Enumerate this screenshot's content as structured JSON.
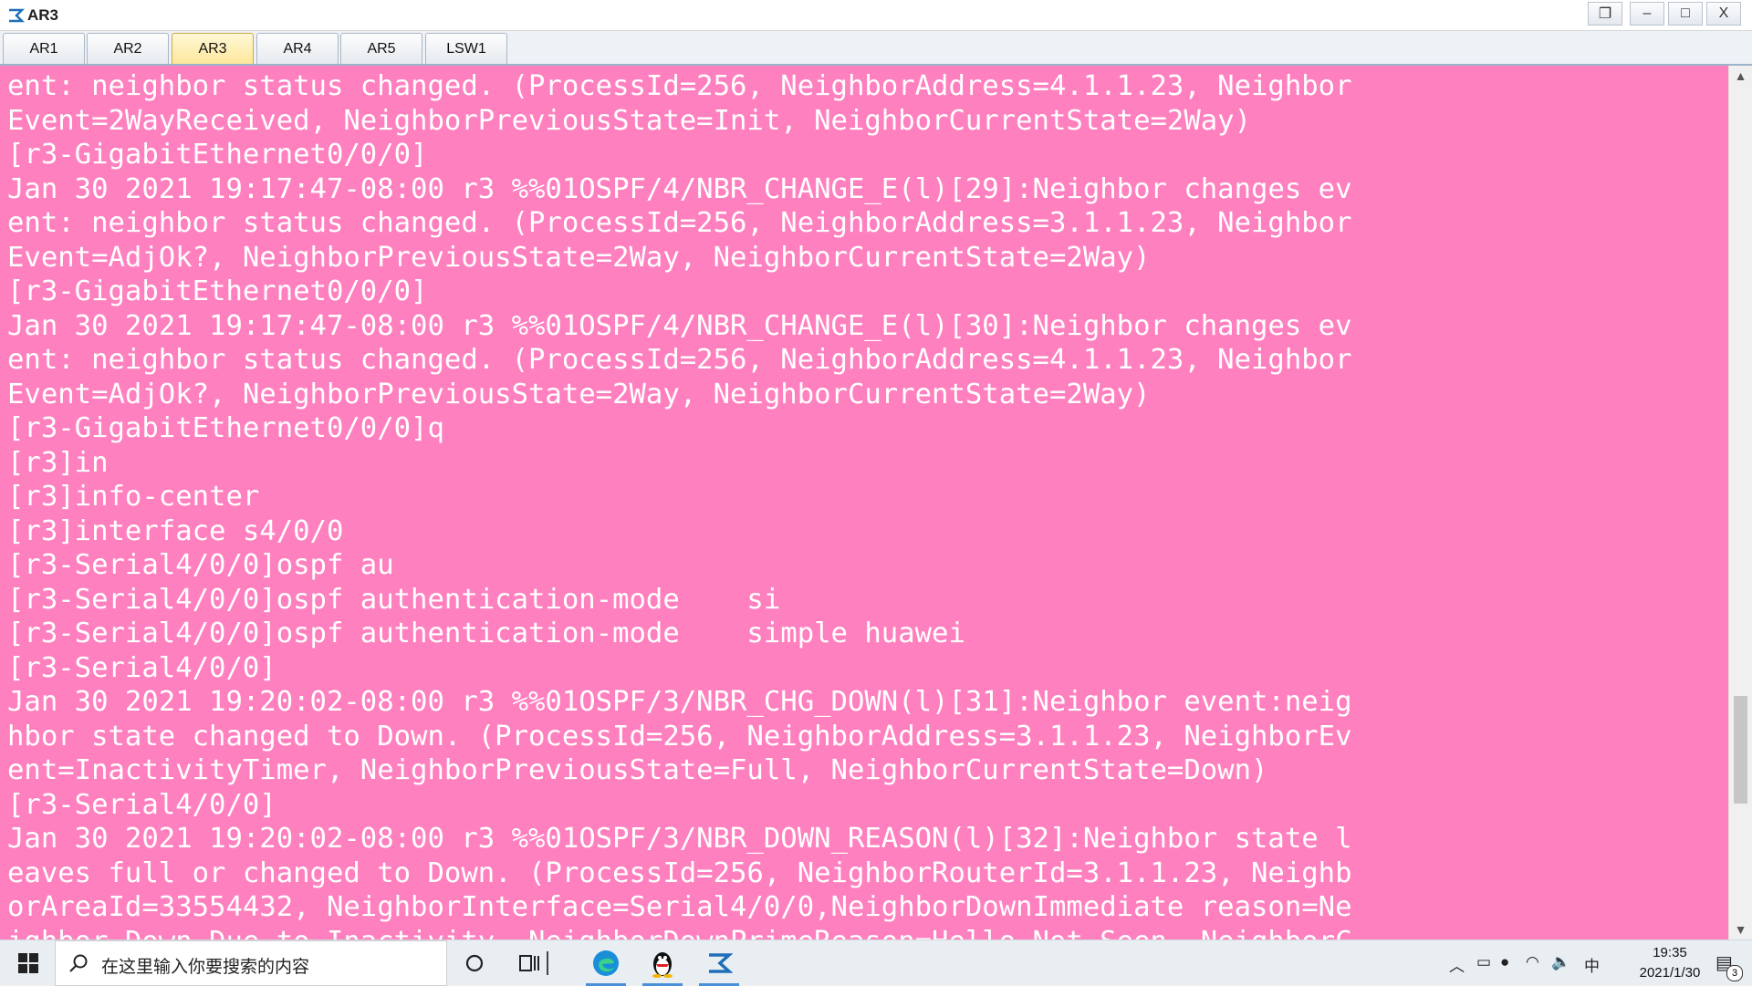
{
  "window": {
    "title": "AR3",
    "controls": {
      "restore": "❐",
      "minimize": "–",
      "maximize": "□",
      "close": "X"
    }
  },
  "tabs": [
    {
      "label": "AR1",
      "active": false
    },
    {
      "label": "AR2",
      "active": false
    },
    {
      "label": "AR3",
      "active": true
    },
    {
      "label": "AR4",
      "active": false
    },
    {
      "label": "AR5",
      "active": false
    },
    {
      "label": "LSW1",
      "active": false
    }
  ],
  "terminal": {
    "background": "#ff80bf",
    "text_color": "#ffffff",
    "lines": [
      "ent: neighbor status changed. (ProcessId=256, NeighborAddress=4.1.1.23, Neighbor",
      "Event=2WayReceived, NeighborPreviousState=Init, NeighborCurrentState=2Way)",
      "[r3-GigabitEthernet0/0/0]",
      "Jan 30 2021 19:17:47-08:00 r3 %%01OSPF/4/NBR_CHANGE_E(l)[29]:Neighbor changes ev",
      "ent: neighbor status changed. (ProcessId=256, NeighborAddress=3.1.1.23, Neighbor",
      "Event=AdjOk?, NeighborPreviousState=2Way, NeighborCurrentState=2Way)",
      "[r3-GigabitEthernet0/0/0]",
      "Jan 30 2021 19:17:47-08:00 r3 %%01OSPF/4/NBR_CHANGE_E(l)[30]:Neighbor changes ev",
      "ent: neighbor status changed. (ProcessId=256, NeighborAddress=4.1.1.23, Neighbor",
      "Event=AdjOk?, NeighborPreviousState=2Way, NeighborCurrentState=2Way)",
      "[r3-GigabitEthernet0/0/0]q",
      "[r3]in",
      "[r3]info-center",
      "[r3]interface s4/0/0",
      "[r3-Serial4/0/0]ospf au",
      "[r3-Serial4/0/0]ospf authentication-mode    si",
      "[r3-Serial4/0/0]ospf authentication-mode    simple huawei",
      "[r3-Serial4/0/0]",
      "Jan 30 2021 19:20:02-08:00 r3 %%01OSPF/3/NBR_CHG_DOWN(l)[31]:Neighbor event:neig",
      "hbor state changed to Down. (ProcessId=256, NeighborAddress=3.1.1.23, NeighborEv",
      "ent=InactivityTimer, NeighborPreviousState=Full, NeighborCurrentState=Down)",
      "[r3-Serial4/0/0]",
      "Jan 30 2021 19:20:02-08:00 r3 %%01OSPF/3/NBR_DOWN_REASON(l)[32]:Neighbor state l",
      "eaves full or changed to Down. (ProcessId=256, NeighborRouterId=3.1.1.23, Neighb",
      "orAreaId=33554432, NeighborInterface=Serial4/0/0,NeighborDownImmediate reason=Ne",
      "ighbor Down Due to Inactivity, NeighborDownPrimeReason=Hello Not Seen, NeighborC"
    ]
  },
  "scrollbar": {
    "position_fraction": 0.84
  },
  "taskbar": {
    "search_placeholder": "在这里输入你要搜索的内容",
    "tray_ime": "中",
    "clock_time": "19:35",
    "clock_date": "2021/1/30",
    "notification_count": "3"
  },
  "colors": {
    "accent": "#4a90d9",
    "active_tab": "#fde79a"
  }
}
